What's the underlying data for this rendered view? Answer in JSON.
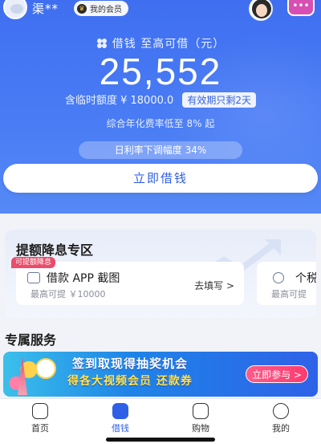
{
  "header": {
    "username": "渠**",
    "vip_label": "我的会员"
  },
  "hero": {
    "title": "借钱 至高可借（元）",
    "amount": "25,552",
    "temp_limit": "含临时额度 ¥ 18000.0",
    "temp_validity": "有效期只剩2天",
    "rate_note": "综合年化费率低至 8% 起",
    "rate_pill": "日利率下调幅度 34%",
    "borrow_button": "立即借钱"
  },
  "promo": {
    "title": "提额降息专区",
    "tag": "可提额降息",
    "cards": [
      {
        "name": "借款 APP 截图",
        "sub": "最高可提 ￥10000",
        "action": "去填写 >"
      },
      {
        "name": "个税",
        "sub": "最高可提"
      }
    ]
  },
  "services": {
    "title": "专属服务",
    "banner_line1": "签到取现得抽奖机会",
    "banner_line2": "得各大视频会员 还款券",
    "banner_cta": "立即参与 >"
  },
  "tabs": [
    {
      "label": "首页",
      "icon": "home-icon"
    },
    {
      "label": "借钱",
      "icon": "wallet-icon",
      "active": true
    },
    {
      "label": "购物",
      "icon": "shopping-bag-icon"
    },
    {
      "label": "我的",
      "icon": "chat-bubble-icon"
    }
  ],
  "colors": {
    "brand_blue": "#3f6ff0",
    "accent_pink": "#ea4d6a",
    "banner_cta": "#ff3b6f"
  }
}
